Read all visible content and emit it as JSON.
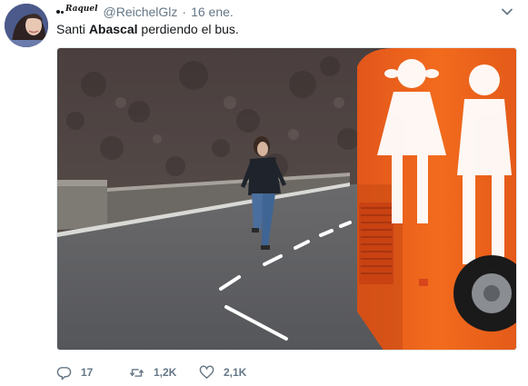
{
  "tweet": {
    "author": {
      "display_name": "Raquel",
      "handle": "@ReichelGlz",
      "avatar_icon": "profile-photo"
    },
    "timestamp": "16 ene.",
    "text_before": "Santi ",
    "text_bold": "Abascal",
    "text_after": " perdiendo el bus.",
    "media_icon": "photo-man-running-after-orange-bus",
    "menu_icon": "chevron-down-icon",
    "stats": {
      "replies": "17",
      "retweets": "1,2K",
      "likes": "2,1K"
    },
    "colors": {
      "text": "#14171a",
      "secondary": "#657786",
      "bus_orange": "#f26b1d"
    }
  }
}
